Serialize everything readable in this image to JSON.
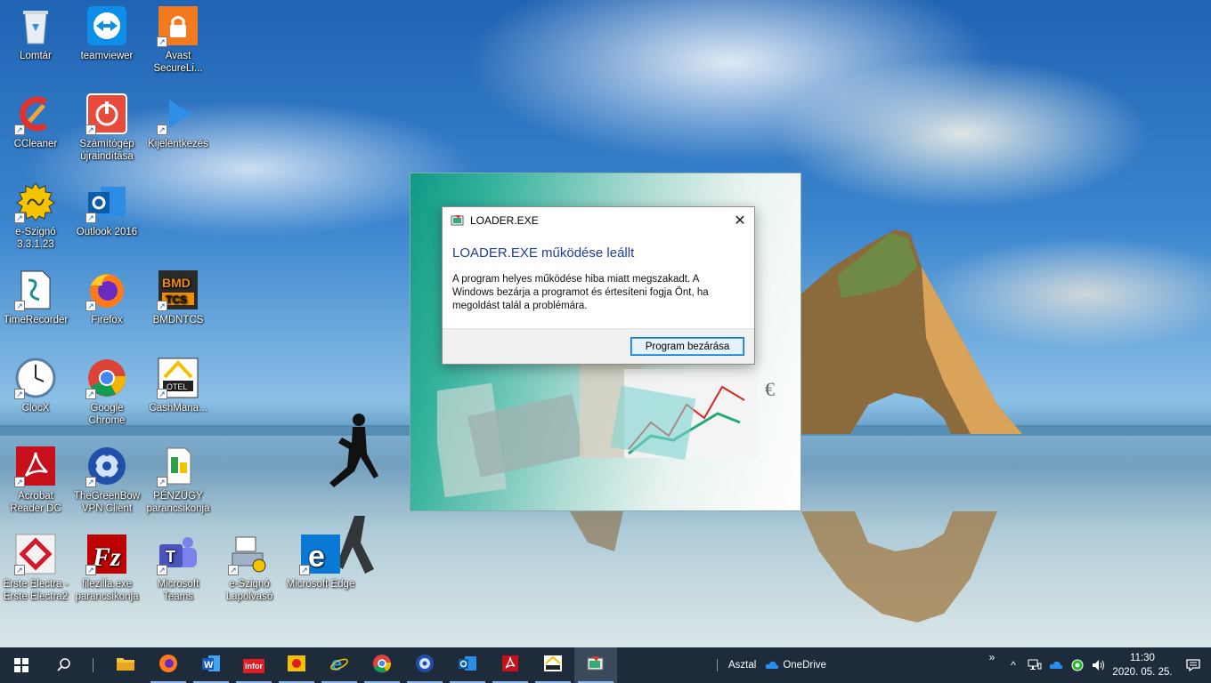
{
  "desktop": {
    "icons": [
      {
        "name": "recycle-bin-icon",
        "label": "Lomtár",
        "shortcut": false
      },
      {
        "name": "teamviewer-icon",
        "label": "teamviewer",
        "shortcut": false
      },
      {
        "name": "avast-icon",
        "label": "Avast SecureLi...",
        "shortcut": true
      },
      {
        "name": "ccleaner-icon",
        "label": "CCleaner",
        "shortcut": true
      },
      {
        "name": "restart-icon",
        "label": "Számítógép újraindítása",
        "shortcut": true
      },
      {
        "name": "logout-icon",
        "label": "Kijelentkezés",
        "shortcut": true
      },
      {
        "name": "e-szigno-icon",
        "label": "e-Szignó 3.3.1.23",
        "shortcut": true
      },
      {
        "name": "outlook-icon",
        "label": "Outlook 2016",
        "shortcut": true
      },
      {
        "name": "timerecorder-icon",
        "label": "TimeRecorder",
        "shortcut": true
      },
      {
        "name": "firefox-icon",
        "label": "Firefox",
        "shortcut": true
      },
      {
        "name": "bmdntcs-icon",
        "label": "BMDNTCS",
        "shortcut": true
      },
      {
        "name": "clocx-icon",
        "label": "ClocX",
        "shortcut": true
      },
      {
        "name": "chrome-icon",
        "label": "Google Chrome",
        "shortcut": true
      },
      {
        "name": "cashmanager-icon",
        "label": "CashMana...",
        "shortcut": true
      },
      {
        "name": "acrobat-icon",
        "label": "Acrobat Reader DC",
        "shortcut": true
      },
      {
        "name": "greenbow-vpn-icon",
        "label": "TheGreenBow VPN Client",
        "shortcut": true
      },
      {
        "name": "penzugy-icon",
        "label": "PÉNZÜGY parancsikonja",
        "shortcut": true
      },
      {
        "name": "erste-electra-icon",
        "label": "Erste Electra - Erste Electra2",
        "shortcut": true
      },
      {
        "name": "filezilla-icon",
        "label": "filezilla.exe parancsikonja",
        "shortcut": true
      },
      {
        "name": "teams-icon",
        "label": "Microsoft Teams",
        "shortcut": true
      },
      {
        "name": "e-szigno-reader-icon",
        "label": "e-Szignó Lapolvasó",
        "shortcut": true
      },
      {
        "name": "edge-icon",
        "label": "Microsoft Edge",
        "shortcut": true
      }
    ]
  },
  "dialog": {
    "title": "LOADER.EXE",
    "heading": "LOADER.EXE működése leállt",
    "message": "A program helyes működése hiba miatt megszakadt. A Windows bezárja a programot és értesíteni fogja Önt, ha megoldást talál a problémára.",
    "button_label": "Program bezárása",
    "close_glyph": "✕"
  },
  "taskbar": {
    "toolbar_label": "Asztal",
    "onedrive_label": "OneDrive",
    "apps": [
      "file-explorer-icon",
      "firefox-icon",
      "word-icon",
      "infor-icon",
      "red-dot-app-icon",
      "internet-explorer-icon",
      "chrome-icon",
      "greenbow-vpn-icon",
      "outlook-icon",
      "acrobat-icon",
      "cashmanager-icon",
      "loader-icon"
    ],
    "infor_label": "infor",
    "clock_time": "11:30",
    "clock_date": "2020. 05. 25.",
    "chevron_up": "^",
    "more": "»"
  },
  "colors": {
    "taskbar_bg": "#1d2b3a",
    "dialog_heading": "#1f3d99",
    "button_border": "#0078d7"
  }
}
